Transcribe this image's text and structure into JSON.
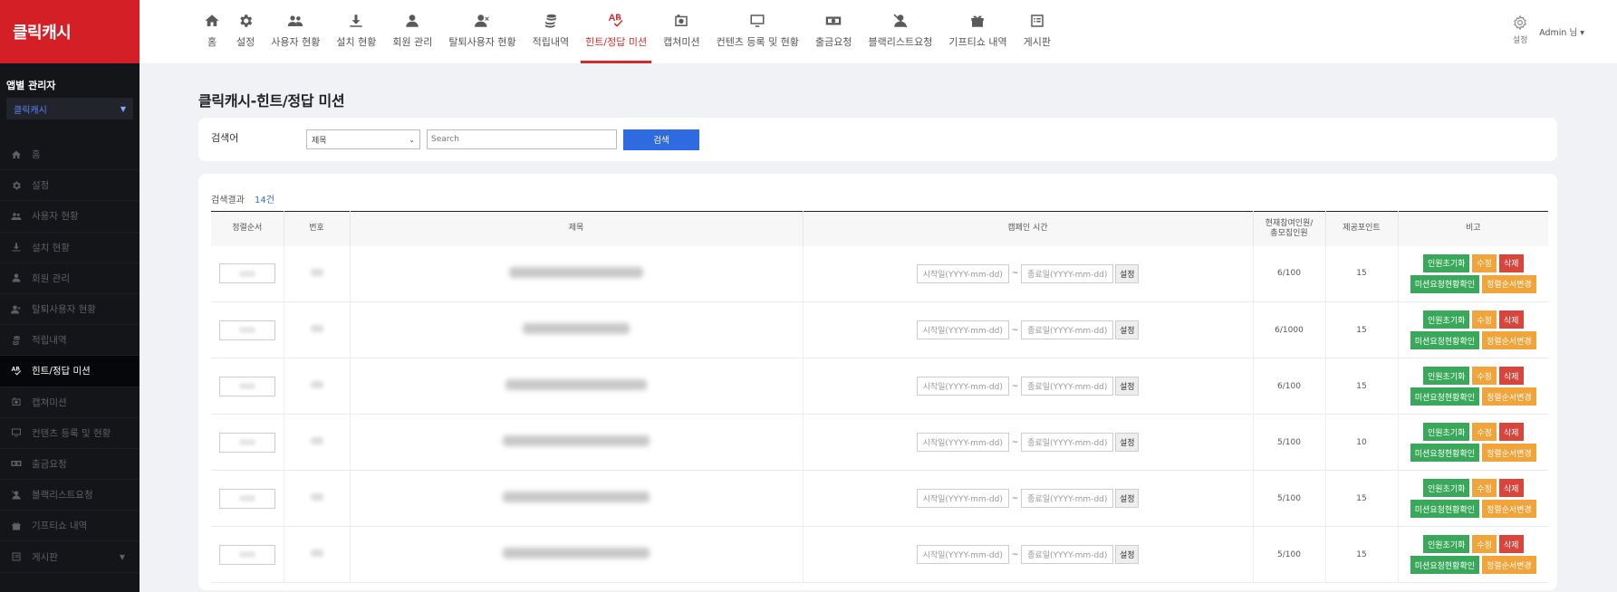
{
  "brand": "클릭캐시",
  "sidebar": {
    "app_label": "앱별 관리자",
    "app_select": "클릭캐시",
    "items": [
      {
        "label": "홈",
        "icon": "home-icon",
        "active": false
      },
      {
        "label": "설정",
        "icon": "gear-icon",
        "active": false
      },
      {
        "label": "사용자 현황",
        "icon": "users-icon",
        "active": false
      },
      {
        "label": "설치 현황",
        "icon": "download-icon",
        "active": false
      },
      {
        "label": "회원 관리",
        "icon": "user-icon",
        "active": false
      },
      {
        "label": "탈퇴사용자 현황",
        "icon": "user-x-icon",
        "active": false
      },
      {
        "label": "적립내역",
        "icon": "coins-icon",
        "active": false
      },
      {
        "label": "힌트/정답 미션",
        "icon": "spellcheck-icon",
        "active": true
      },
      {
        "label": "캡쳐미션",
        "icon": "camera-icon",
        "active": false
      },
      {
        "label": "컨텐츠 등록 및 현황",
        "icon": "monitor-icon",
        "active": false
      },
      {
        "label": "출금요청",
        "icon": "money-icon",
        "active": false
      },
      {
        "label": "블랙리스트요청",
        "icon": "user-slash-icon",
        "active": false
      },
      {
        "label": "기프티쇼 내역",
        "icon": "gift-icon",
        "active": false
      },
      {
        "label": "게시판",
        "icon": "list-icon",
        "active": false
      }
    ]
  },
  "topnav": [
    {
      "label": "홈",
      "icon": "home-icon",
      "active": false
    },
    {
      "label": "설정",
      "icon": "gear-icon",
      "active": false
    },
    {
      "label": "사용자 현황",
      "icon": "users-icon",
      "active": false
    },
    {
      "label": "설치 현황",
      "icon": "download-icon",
      "active": false
    },
    {
      "label": "회원 관리",
      "icon": "user-icon",
      "active": false
    },
    {
      "label": "탈퇴사용자 현황",
      "icon": "user-x-icon",
      "active": false
    },
    {
      "label": "적립내역",
      "icon": "coins-icon",
      "active": false
    },
    {
      "label": "힌트/정답 미션",
      "icon": "spellcheck-icon",
      "active": true
    },
    {
      "label": "캡쳐미션",
      "icon": "camera-icon",
      "active": false
    },
    {
      "label": "컨텐츠 등록 및 현황",
      "icon": "monitor-icon",
      "active": false
    },
    {
      "label": "출금요청",
      "icon": "money-icon",
      "active": false
    },
    {
      "label": "블랙리스트요청",
      "icon": "user-slash-icon",
      "active": false
    },
    {
      "label": "기프티쇼 내역",
      "icon": "gift-icon",
      "active": false
    },
    {
      "label": "게시판",
      "icon": "list-icon",
      "active": false
    }
  ],
  "top_right": {
    "settings_label": "설정",
    "admin_label": "Admin 님 ▾"
  },
  "page": {
    "title": "클릭캐시-힌트/정답 미션"
  },
  "search": {
    "label": "검색어",
    "select_value": "제목",
    "input_placeholder": "Search",
    "button_label": "검색"
  },
  "results": {
    "label": "검색결과",
    "count": "14건",
    "columns": [
      "정렬순서",
      "번호",
      "제목",
      "캠페인 시간",
      "현재참여인원/\n총모집인원",
      "제공포인트",
      "비고"
    ],
    "date_start_placeholder": "시작일(YYYY-mm-dd)",
    "date_end_placeholder": "종료일(YYYY-mm-dd)",
    "tilde": "~",
    "set_label": "설정",
    "btn_reset": "인원초기화",
    "btn_edit": "수정",
    "btn_delete": "삭제",
    "btn_status": "미션요청현황확인",
    "btn_order": "정렬순서변경",
    "rows": [
      {
        "participants": "6/100",
        "points": "15"
      },
      {
        "participants": "6/1000",
        "points": "15"
      },
      {
        "participants": "6/100",
        "points": "15"
      },
      {
        "participants": "5/100",
        "points": "10"
      },
      {
        "participants": "5/100",
        "points": "15"
      },
      {
        "participants": "5/100",
        "points": "15"
      }
    ]
  }
}
